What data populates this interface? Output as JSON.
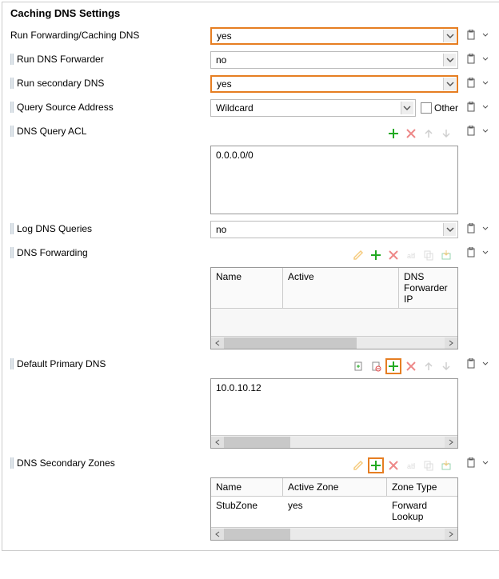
{
  "title": "Caching DNS Settings",
  "fields": {
    "runForwardingCaching": {
      "label": "Run Forwarding/Caching DNS",
      "value": "yes",
      "highlight": true
    },
    "runDnsForwarder": {
      "label": "Run DNS Forwarder",
      "value": "no",
      "highlight": false
    },
    "runSecondaryDns": {
      "label": "Run secondary DNS",
      "value": "yes",
      "highlight": true
    },
    "querySourceAddress": {
      "label": "Query Source Address",
      "value": "Wildcard",
      "otherLabel": "Other"
    },
    "dnsQueryAcl": {
      "label": "DNS Query ACL",
      "items": [
        "0.0.0.0/0"
      ]
    },
    "logDnsQueries": {
      "label": "Log DNS Queries",
      "value": "no"
    },
    "dnsForwarding": {
      "label": "DNS Forwarding",
      "columns": [
        "Name",
        "Active",
        "DNS Forwarder IP"
      ],
      "rows": []
    },
    "defaultPrimaryDns": {
      "label": "Default Primary DNS",
      "items": [
        "10.0.10.12"
      ]
    },
    "dnsSecondaryZones": {
      "label": "DNS Secondary Zones",
      "columns": [
        "Name",
        "Active Zone",
        "Zone Type"
      ],
      "rows": [
        {
          "name": "StubZone",
          "active": "yes",
          "type": "Forward Lookup"
        }
      ]
    }
  }
}
